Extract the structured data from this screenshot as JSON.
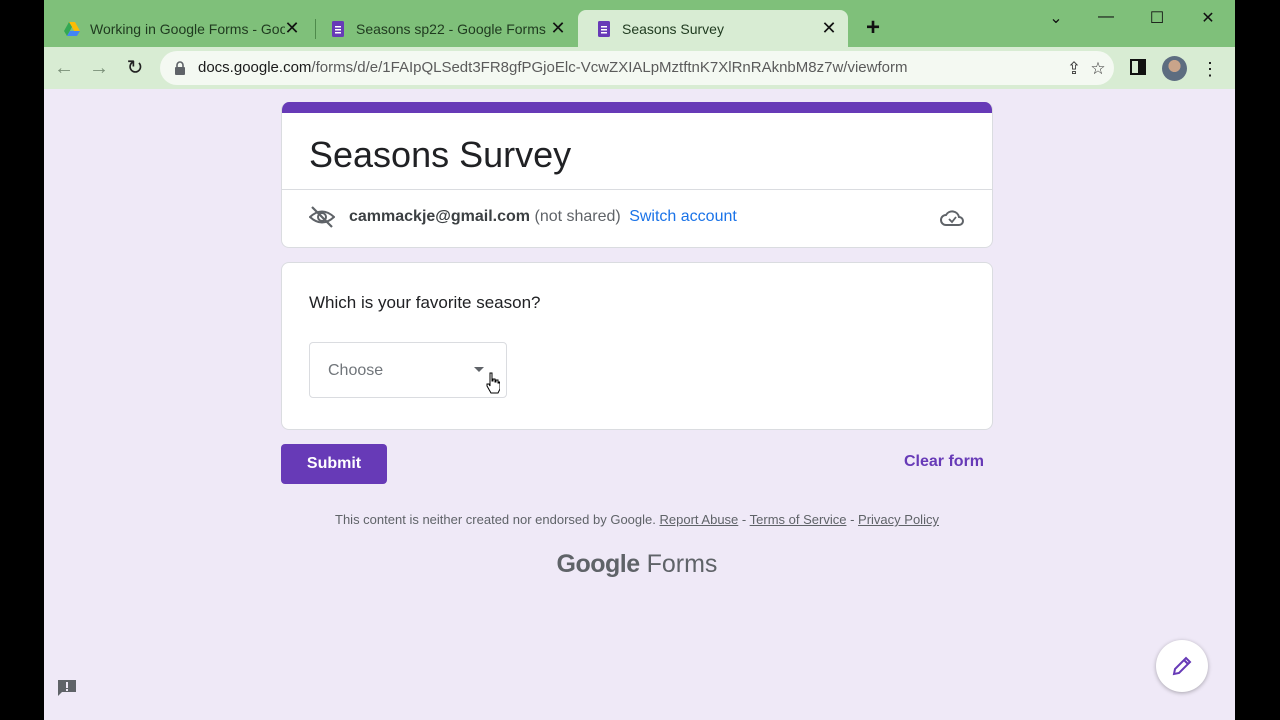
{
  "browser": {
    "tabs": [
      {
        "title": "Working in Google Forms - Goog",
        "icon": "google-drive-icon"
      },
      {
        "title": "Seasons sp22 - Google Forms",
        "icon": "google-forms-icon"
      },
      {
        "title": "Seasons Survey",
        "icon": "google-forms-icon",
        "active": true
      }
    ],
    "url_host": "docs.google.com",
    "url_path": "/forms/d/e/1FAIpQLSedt3FR8gfPGjoElc-VcwZXIALpMztftnK7XlRnRAknbM8z7w/viewform"
  },
  "form": {
    "title": "Seasons Survey",
    "account_email": "cammackje@gmail.com",
    "account_note": "(not shared)",
    "switch_account": "Switch account",
    "question": "Which is your favorite season?",
    "dropdown_placeholder": "Choose",
    "submit_label": "Submit",
    "clear_label": "Clear form"
  },
  "footer": {
    "disclaimer": "This content is neither created nor endorsed by Google.",
    "report_abuse": "Report Abuse",
    "sep": "-",
    "terms": "Terms of Service",
    "privacy": "Privacy Policy",
    "brand_google": "Google",
    "brand_forms": "Forms"
  },
  "colors": {
    "accent": "#673ab7",
    "tabstrip": "#7fc07a",
    "page_bg": "#efe9f7"
  }
}
